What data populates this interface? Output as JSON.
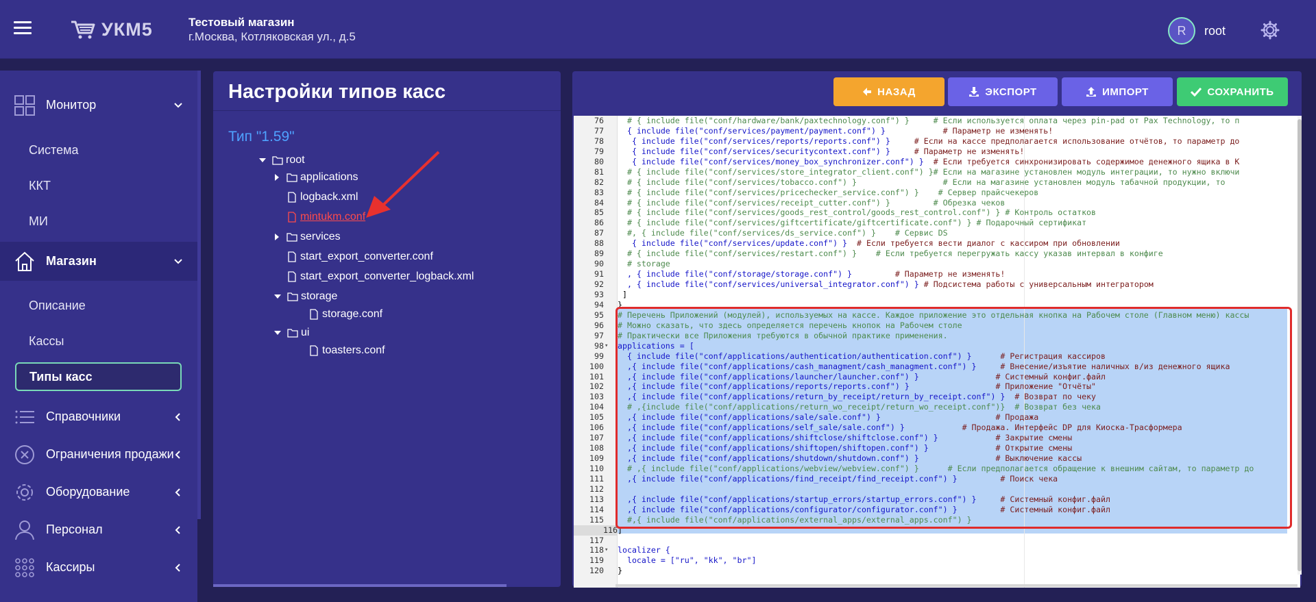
{
  "header": {
    "app_name": "УКМ5",
    "store_name": "Тестовый магазин",
    "store_address": "г.Москва, Котляковская ул., д.5",
    "user_initial": "R",
    "user_name": "root"
  },
  "sidebar": {
    "monitor": "Монитор",
    "sub1": [
      "Система",
      "ККТ",
      "МИ"
    ],
    "shop": "Магазин",
    "sub2": [
      "Описание",
      "Кассы",
      "Типы касс"
    ],
    "items": [
      "Справочники",
      "Ограничения продажи",
      "Оборудование",
      "Персонал",
      "Кассиры"
    ]
  },
  "panel": {
    "title": "Настройки типов касс",
    "type_label": "Тип \"1.59\"",
    "tree": [
      "root",
      "applications",
      "logback.xml",
      "mintukm.conf",
      "services",
      "start_export_converter.conf",
      "start_export_converter_logback.xml",
      "storage",
      "storage.conf",
      "ui",
      "toasters.conf"
    ]
  },
  "toolbar": {
    "back": "НАЗАД",
    "export": "ЭКСПОРТ",
    "import": "ИМПОРТ",
    "save": "СОХРАНИТЬ"
  },
  "colors": {
    "accent": "#36318a",
    "back": "#f4a52e",
    "export": "#6a62e6",
    "save": "#3ecb74",
    "highlight": "#e02b2b",
    "link": "#4fa2ff"
  },
  "code_lines": [
    {
      "n": "76",
      "t": "  # { include file(\"conf/hardware/bank/paxtechnology.conf\") }     # Если используется оплата через pin-pad от Pax Technology, то п"
    },
    {
      "n": "77",
      "t": "  { include file(\"conf/services/payment/payment.conf\") }            # Параметр не изменять!"
    },
    {
      "n": "78",
      "t": "   { include file(\"conf/services/reports/reports.conf\") }     # Если на кассе предполагается использование отчётов, то параметр до"
    },
    {
      "n": "79",
      "t": "   { include file(\"conf/services/securitycontext.conf\") }     # Параметр не изменять!"
    },
    {
      "n": "80",
      "t": "   { include file(\"conf/services/money_box_synchronizer.conf\") }  # Если требуется синхронизировать содержимое денежного ящика в К"
    },
    {
      "n": "81",
      "t": "  # { include file(\"conf/services/store_integrator_client.conf\") }# Если на магазине установлен модуль интеграции, то нужно включи"
    },
    {
      "n": "82",
      "t": "  # { include file(\"conf/services/tobacco.conf\") }                  # Если на магазине установлен модуль табачной продукции, то"
    },
    {
      "n": "83",
      "t": "  # { include file(\"conf/services/pricechecker_service.conf\") }    # Сервер прайсчекеров"
    },
    {
      "n": "84",
      "t": "  # { include file(\"conf/services/receipt_cutter.conf\") }         # Обрезка чеков"
    },
    {
      "n": "85",
      "t": "  # { include file(\"conf/services/goods_rest_control/goods_rest_control.conf\") } # Контроль остатков"
    },
    {
      "n": "86",
      "t": "  # { include file(\"conf/services/giftcertificate/giftcertificate.conf\") } # Подарочный сертификат"
    },
    {
      "n": "87",
      "t": "  #, { include file(\"conf/services/ds_service.conf\") }    # Сервис DS"
    },
    {
      "n": "88",
      "t": "   { include file(\"conf/services/update.conf\") }  # Если требуется вести диалог с кассиром при обновлении"
    },
    {
      "n": "89",
      "t": "  # { include file(\"conf/services/restart.conf\") }    # Если требуется перегружать кассу указав интервал в конфиге"
    },
    {
      "n": "90",
      "t": "  # storage"
    },
    {
      "n": "91",
      "t": "  , { include file(\"conf/storage/storage.conf\") }         # Параметр не изменять!"
    },
    {
      "n": "92",
      "t": "  , { include file(\"conf/services/universal_integrator.conf\") } # Подсистема работы с универсальным интегратором"
    },
    {
      "n": "93",
      "t": " ]"
    },
    {
      "n": "94",
      "t": "}"
    },
    {
      "n": "95",
      "t": "# Перечень Приложений (модулей), используемых на кассе. Каждое приложение это отдельная кнопка на Рабочем столе (Главном меню) кассы"
    },
    {
      "n": "96",
      "t": "# Можно сказать, что здесь определяется перечень кнопок на Рабочем столе"
    },
    {
      "n": "97",
      "t": "# Практически все Приложения требуются в обычной практике применения."
    },
    {
      "n": "98",
      "t": "applications = ["
    },
    {
      "n": "99",
      "t": "  { include file(\"conf/applications/authentication/authentication.conf\") }      # Регистрация кассиров"
    },
    {
      "n": "100",
      "t": "  ,{ include file(\"conf/applications/cash_managment/cash_managment.conf\") }     # Внесение/изъятие наличных в/из денежного ящика"
    },
    {
      "n": "101",
      "t": "  ,{ include file(\"conf/applications/launcher/launcher.conf\") }                # Системный конфиг.файл"
    },
    {
      "n": "102",
      "t": "  ,{ include file(\"conf/applications/reports/reports.conf\") }                  # Приложение \"Отчёты\""
    },
    {
      "n": "103",
      "t": "  ,{ include file(\"conf/applications/return_by_receipt/return_by_receipt.conf\") }  # Возврат по чеку"
    },
    {
      "n": "104",
      "t": "  # ,{include file(\"conf/applications/return_wo_receipt/return_wo_receipt.conf\")}  # Возврат без чека"
    },
    {
      "n": "105",
      "t": "  ,{ include file(\"conf/applications/sale/sale.conf\") }                        # Продажа"
    },
    {
      "n": "106",
      "t": "  ,{ include file(\"conf/applications/self_sale/sale.conf\") }            # Продажа. Интерфейс DP для Киоска-Трасформера"
    },
    {
      "n": "107",
      "t": "  ,{ include file(\"conf/applications/shiftclose/shiftclose.conf\") }            # Закрытие смены"
    },
    {
      "n": "108",
      "t": "  ,{ include file(\"conf/applications/shiftopen/shiftopen.conf\") }              # Открытие смены"
    },
    {
      "n": "109",
      "t": "  ,{ include file(\"conf/applications/shutdown/shutdown.conf\") }                # Выключение кассы"
    },
    {
      "n": "110",
      "t": "  # ,{ include file(\"conf/applications/webview/webview.conf\") }      # Если предполагается обращение к внешним сайтам, то параметр до"
    },
    {
      "n": "111",
      "t": "  ,{ include file(\"conf/applications/find_receipt/find_receipt.conf\") }         # Поиск чека"
    },
    {
      "n": "112",
      "t": ""
    },
    {
      "n": "113",
      "t": "  ,{ include file(\"conf/applications/startup_errors/startup_errors.conf\") }     # Системный конфиг.файл"
    },
    {
      "n": "114",
      "t": "  ,{ include file(\"conf/applications/configurator/configurator.conf\") }         # Системный конфиг.файл"
    },
    {
      "n": "115",
      "t": "  #,{ include file(\"conf/applications/external_apps/external_apps.conf\") }"
    },
    {
      "n": "116",
      "t": "]"
    },
    {
      "n": "117",
      "t": ""
    },
    {
      "n": "118",
      "t": "localizer {"
    },
    {
      "n": "119",
      "t": "  locale = [\"ru\", \"kk\", \"br\"]"
    },
    {
      "n": "120",
      "t": "}"
    }
  ]
}
